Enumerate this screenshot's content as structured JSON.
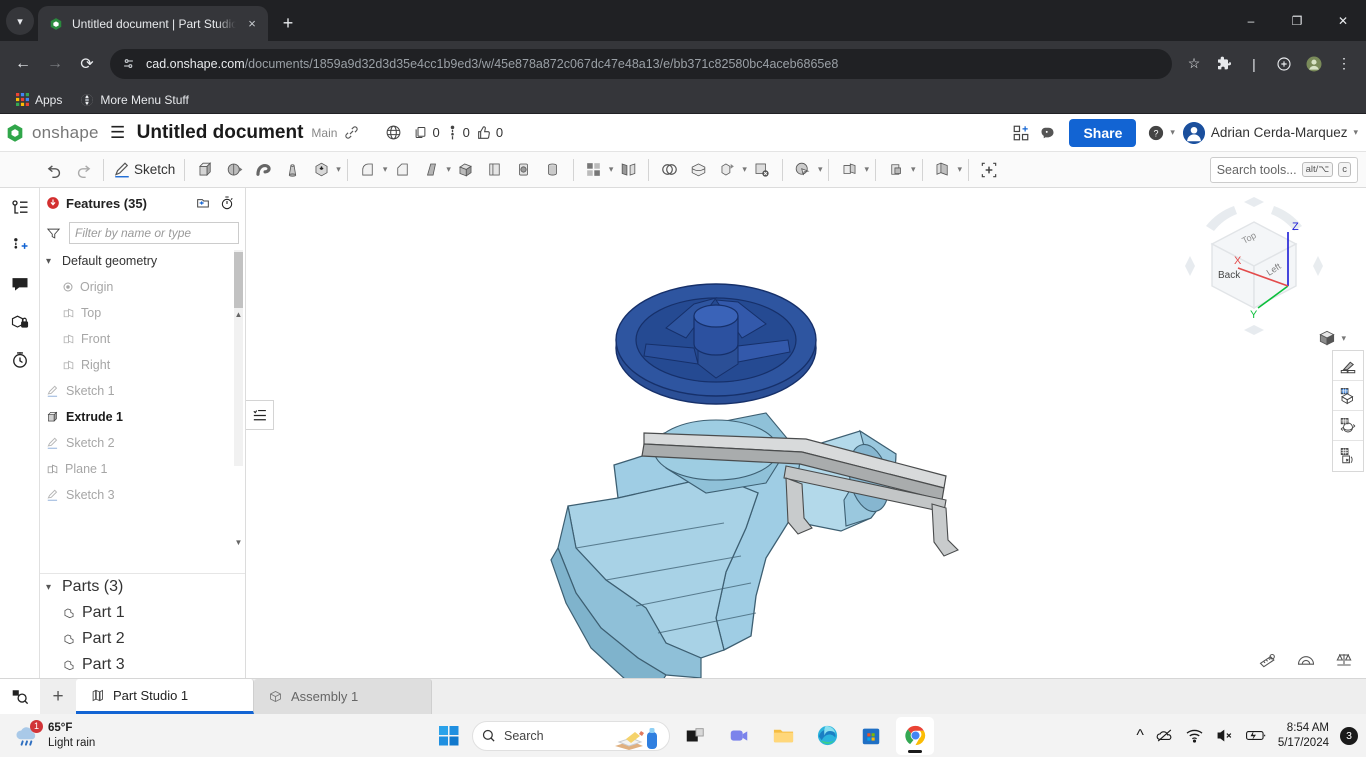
{
  "browser": {
    "tab": {
      "title": "Untitled document | Part Studio",
      "favicon": "onshape-icon",
      "close": "×"
    },
    "new_tab_label": "+",
    "window_controls": {
      "minimize": "–",
      "maximize": "❐",
      "close": "✕"
    },
    "nav": {
      "back": "←",
      "forward": "→",
      "reload": "⟳"
    },
    "url": {
      "domain": "cad.onshape.com",
      "path": "/documents/1859a9d32d3d35e4cc1b9ed3/w/45e878a872c067dc47e48a13/e/bb371c82580bc4aceb6865e8"
    },
    "toolbar_icons": [
      "star-icon",
      "extensions-icon",
      "divider",
      "passwords-icon",
      "profile-avatar",
      "chrome-menu-icon"
    ],
    "bookmarks": [
      {
        "label": "Apps",
        "icon": "apps-grid-icon"
      },
      {
        "label": "More Menu Stuff",
        "icon": "globe-icon"
      }
    ]
  },
  "onshape": {
    "header": {
      "logo_text": "onshape",
      "menu_icon": "hamburger-icon",
      "document_title": "Untitled document",
      "branch": "Main",
      "link_icon": "link-icon",
      "globe_icon": "globe-icon",
      "counters": [
        {
          "icon": "copy-icon",
          "value": "0"
        },
        {
          "icon": "versions-icon",
          "value": "0"
        },
        {
          "icon": "thumbs-up-icon",
          "value": "0"
        }
      ],
      "apps_icon": "add-app-icon",
      "brain_icon": "ai-assistant-icon",
      "share_label": "Share",
      "help_icon": "help-icon",
      "user_name": "Adrian Cerda-Marquez"
    },
    "toolbar": {
      "undo": "undo-icon",
      "redo": "redo-icon",
      "sketch_label": "Sketch",
      "tools": [
        "extrude-icon",
        "revolve-icon",
        "sweep-icon",
        "loft-icon",
        "thicken-icon",
        "fillet-icon",
        "chamfer-icon",
        "draft-icon",
        "shell-icon",
        "hole-icon",
        "thread-icon",
        "pattern-icon",
        "mirror-icon",
        "boolean-icon",
        "split-icon",
        "transform-icon",
        "delete-face-icon",
        "move-face-icon",
        "plane-icon",
        "derive-icon",
        "sheet-metal-icon",
        "insert-icon"
      ],
      "search_placeholder": "Search tools...",
      "search_keys": [
        "alt/⌥",
        "c"
      ]
    },
    "left_rail": [
      "feature-list-icon",
      "insert-version-icon",
      "comments-icon",
      "hidden-parts-icon",
      "history-icon"
    ],
    "features_panel": {
      "error_icon": "rollback-icon",
      "title": "Features (35)",
      "add_folder_icon": "add-folder-icon",
      "timer_icon": "feature-timer-icon",
      "filter_icon": "filter-icon",
      "filter_placeholder": "Filter by name or type",
      "groups": [
        {
          "label": "Default geometry",
          "expanded": true,
          "items": [
            {
              "label": "Origin",
              "icon": "origin-icon",
              "muted": true
            },
            {
              "label": "Top",
              "icon": "plane-icon",
              "muted": true
            },
            {
              "label": "Front",
              "icon": "plane-icon",
              "muted": true
            },
            {
              "label": "Right",
              "icon": "plane-icon",
              "muted": true
            }
          ]
        }
      ],
      "features": [
        {
          "label": "Sketch 1",
          "icon": "sketch-icon",
          "muted": true
        },
        {
          "label": "Extrude 1",
          "icon": "extrude-icon",
          "muted": false,
          "bold": true
        },
        {
          "label": "Sketch 2",
          "icon": "sketch-icon",
          "muted": true
        },
        {
          "label": "Plane 1",
          "icon": "plane-icon",
          "muted": true
        },
        {
          "label": "Sketch 3",
          "icon": "sketch-icon",
          "muted": true
        }
      ],
      "parts": {
        "label": "Parts (3)",
        "items": [
          {
            "label": "Part 1",
            "icon": "part-icon"
          },
          {
            "label": "Part 2",
            "icon": "part-icon"
          },
          {
            "label": "Part 3",
            "icon": "part-icon"
          }
        ]
      }
    },
    "viewport": {
      "flyout_icon": "feature-list-flyout-icon",
      "view_cube": {
        "faces": [
          "Back",
          "Left",
          "Top"
        ],
        "axes": [
          "X",
          "Y",
          "Z"
        ],
        "view_style_icon": "view-style-cube-icon"
      },
      "right_tools": [
        "appearance-icon",
        "display-grid-icon",
        "rotate-grid-icon",
        "grid-settings-icon"
      ],
      "measure_tools": [
        "measure-ruler-icon",
        "measure-angle-icon",
        "mass-properties-icon"
      ],
      "model_colors": {
        "wheel": "#24478f",
        "bracket": "#8ec4df",
        "arm": "#c9cbcc"
      }
    },
    "doc_tabs": {
      "search_icon": "tab-search-icon",
      "add_label": "+",
      "tabs": [
        {
          "label": "Part Studio 1",
          "icon": "part-studio-icon",
          "active": true
        },
        {
          "label": "Assembly 1",
          "icon": "assembly-icon",
          "active": false
        }
      ]
    }
  },
  "taskbar": {
    "weather": {
      "temp": "65°F",
      "condition": "Light rain",
      "badge": "1",
      "icon": "rain-cloud-icon"
    },
    "start_icon": "windows-start-icon",
    "search_placeholder": "Search",
    "apps": [
      {
        "name": "task-view-icon",
        "active": false
      },
      {
        "name": "teams-icon",
        "active": false
      },
      {
        "name": "file-explorer-icon",
        "active": false
      },
      {
        "name": "edge-icon",
        "active": false
      },
      {
        "name": "microsoft-store-icon",
        "active": false
      },
      {
        "name": "chrome-icon",
        "active": true
      }
    ],
    "tray": {
      "chevron": "show-hidden-icons",
      "icons": [
        "onedrive-off-icon",
        "wifi-icon",
        "volume-muted-icon",
        "battery-charging-icon"
      ],
      "time": "8:54 AM",
      "date": "5/17/2024",
      "notification_count": "3"
    }
  }
}
